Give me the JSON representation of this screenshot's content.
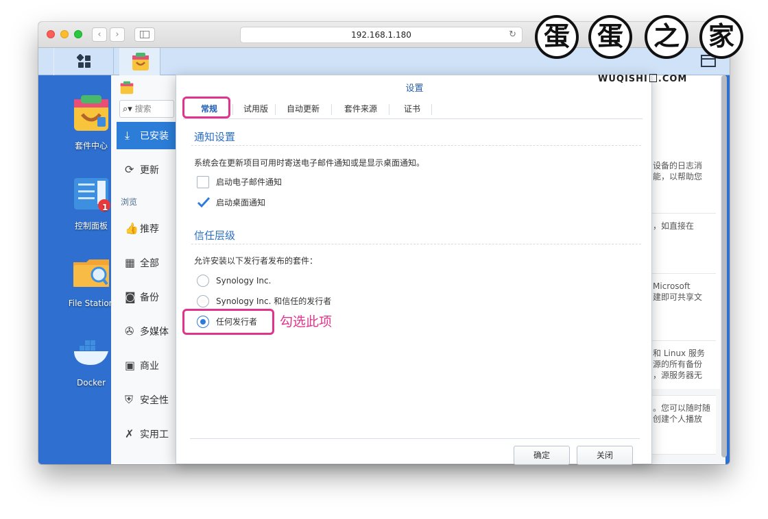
{
  "browser": {
    "url": "192.168.1.180",
    "nav_back": "‹",
    "nav_forward": "›",
    "reload_icon": "↻"
  },
  "desktop": {
    "icons": [
      {
        "label": "套件中心",
        "icon": "package-center-icon"
      },
      {
        "label": "控制面板",
        "icon": "control-panel-icon",
        "badge": "1"
      },
      {
        "label": "File Station",
        "icon": "file-station-icon"
      },
      {
        "label": "Docker",
        "icon": "docker-icon"
      }
    ]
  },
  "package_center": {
    "search_placeholder": "搜索",
    "sidebar": [
      {
        "label": "已安装",
        "icon": "download-icon",
        "active": true
      },
      {
        "label": "更新",
        "icon": "refresh-icon"
      },
      {
        "section": "浏览"
      },
      {
        "label": "推荐",
        "icon": "thumbs-up-icon"
      },
      {
        "label": "全部",
        "icon": "grid-icon"
      },
      {
        "label": "备份",
        "icon": "backup-icon"
      },
      {
        "label": "多媒体",
        "icon": "film-reel-icon"
      },
      {
        "label": "商业",
        "icon": "briefcase-icon"
      },
      {
        "label": "安全性",
        "icon": "shield-icon"
      },
      {
        "label": "实用工",
        "icon": "wrench-icon"
      }
    ],
    "right_snippets": [
      "设备的日志消\n能，以帮助您",
      "，如直接在",
      "Microsoft\n建即可共享文",
      "和 Linux 服务\n源的所有备份\n，源服务器无",
      "。您可以随时随\n创建个人播放"
    ]
  },
  "dialog": {
    "title": "设置",
    "tabs": [
      "常规",
      "试用版",
      "自动更新",
      "套件来源",
      "证书"
    ],
    "active_tab": 0,
    "notify": {
      "title": "通知设置",
      "description": "系统会在更新项目可用时寄送电子邮件通知或是显示桌面通知。",
      "options": [
        {
          "label": "启动电子邮件通知",
          "checked": false
        },
        {
          "label": "启动桌面通知",
          "checked": true
        }
      ]
    },
    "trust": {
      "title": "信任层级",
      "description": "允许安装以下发行者发布的套件：",
      "options": [
        {
          "label": "Synology Inc.",
          "selected": false
        },
        {
          "label": "Synology Inc. 和信任的发行者",
          "selected": false
        },
        {
          "label": "任何发行者",
          "selected": true
        }
      ]
    },
    "buttons": {
      "ok": "确定",
      "close": "关闭"
    }
  },
  "annotation": {
    "text": "勾选此项",
    "color": "#e0338c"
  },
  "watermark": {
    "chars": [
      "蛋",
      "蛋",
      "之",
      "家"
    ],
    "subtitle": "WUQISHI",
    "subtitle_suffix": ".COM"
  },
  "colors": {
    "accent": "#2c7dd8",
    "desktop": "#2e6fcf",
    "highlight": "#e0338c"
  }
}
